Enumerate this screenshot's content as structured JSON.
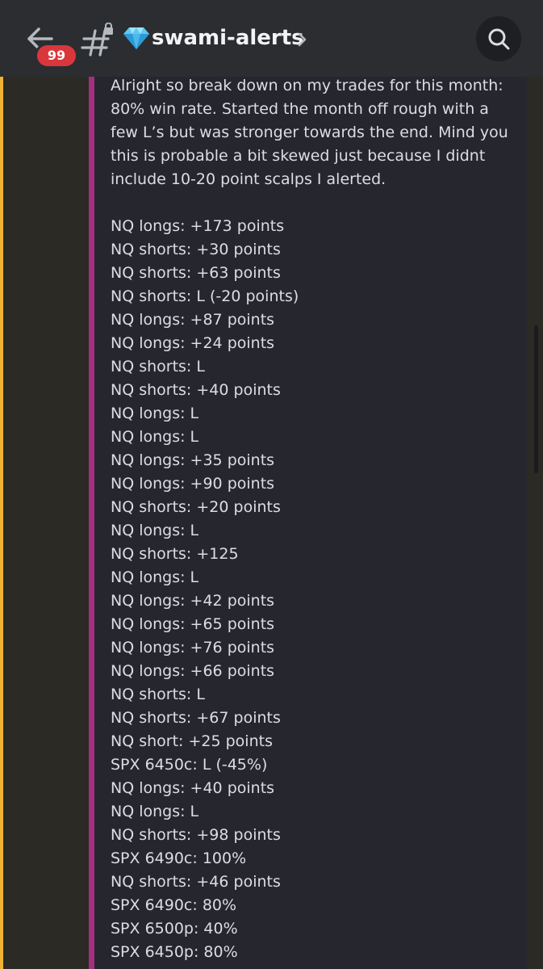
{
  "header": {
    "channel_name": "swami-alerts",
    "unread_badge": "99",
    "icons": {
      "back": "arrow-left-icon",
      "channel": "locked-hash-icon",
      "emoji": "gem-icon",
      "more": "chevron-right-icon",
      "search": "search-icon"
    }
  },
  "message": {
    "intro_lines": [
      "Alright so break down on my trades for this month:",
      "80% win rate. Started the month off rough with a",
      "few L’s but was stronger towards the end. Mind you",
      "this is probable a bit skewed just because I didnt",
      "include 10-20 point scalps I alerted."
    ],
    "trades": [
      "NQ longs: +173 points",
      "NQ shorts: +30 points",
      "NQ shorts: +63 points",
      "NQ shorts: L (-20 points)",
      "NQ longs: +87 points",
      "NQ longs: +24 points",
      "NQ shorts: L",
      "NQ shorts: +40 points",
      "NQ longs: L",
      "NQ longs: L",
      "NQ longs: +35 points",
      "NQ longs: +90 points",
      "NQ shorts: +20 points",
      "NQ longs: L",
      "NQ shorts: +125",
      "NQ longs: L",
      "NQ longs: +42 points",
      "NQ longs: +65 points",
      "NQ longs: +76 points",
      "NQ longs: +66 points",
      "NQ shorts: L",
      "NQ shorts: +67 points",
      "NQ short: +25 points",
      "SPX 6450c: L (-45%)",
      "NQ longs: +40 points",
      "NQ longs: L",
      "NQ shorts: +98 points",
      "SPX 6490c: 100%",
      "NQ shorts: +46 points",
      "SPX 6490c: 80%",
      "SPX 6500p: 40%",
      "SPX 6450p: 80%"
    ]
  },
  "colors": {
    "header_bg": "#2b2d31",
    "message_bg": "#26272e",
    "quote_bar": "#a52f80",
    "mention_bar": "#f0b232",
    "badge_bg": "#da373c",
    "text": "#dbdee1",
    "gem": "#5ec8f0"
  }
}
